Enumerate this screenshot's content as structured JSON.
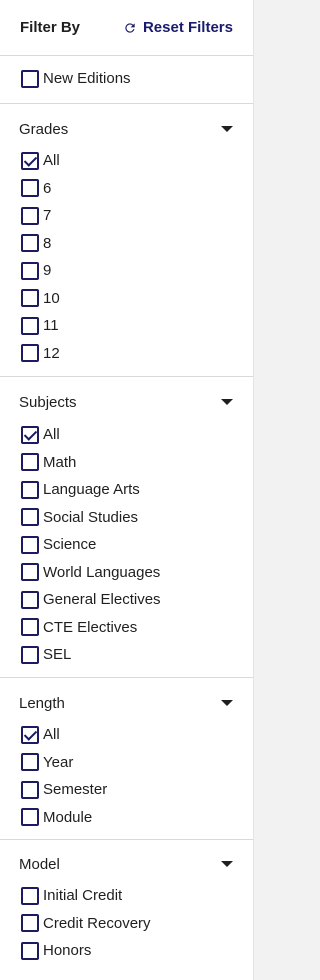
{
  "header": {
    "title": "Filter By",
    "reset_label": "Reset Filters"
  },
  "new_editions": {
    "label": "New Editions",
    "checked": false
  },
  "sections": [
    {
      "key": "grades",
      "title": "Grades",
      "options": [
        {
          "label": "All",
          "checked": true
        },
        {
          "label": "6",
          "checked": false
        },
        {
          "label": "7",
          "checked": false
        },
        {
          "label": "8",
          "checked": false
        },
        {
          "label": "9",
          "checked": false
        },
        {
          "label": "10",
          "checked": false
        },
        {
          "label": "11",
          "checked": false
        },
        {
          "label": "12",
          "checked": false
        }
      ]
    },
    {
      "key": "subjects",
      "title": "Subjects",
      "options": [
        {
          "label": "All",
          "checked": true
        },
        {
          "label": "Math",
          "checked": false
        },
        {
          "label": "Language Arts",
          "checked": false
        },
        {
          "label": "Social Studies",
          "checked": false
        },
        {
          "label": "Science",
          "checked": false
        },
        {
          "label": "World Languages",
          "checked": false
        },
        {
          "label": "General Electives",
          "checked": false
        },
        {
          "label": "CTE Electives",
          "checked": false
        },
        {
          "label": "SEL",
          "checked": false
        }
      ]
    },
    {
      "key": "length",
      "title": "Length",
      "options": [
        {
          "label": "All",
          "checked": true
        },
        {
          "label": "Year",
          "checked": false
        },
        {
          "label": "Semester",
          "checked": false
        },
        {
          "label": "Module",
          "checked": false
        }
      ]
    },
    {
      "key": "model",
      "title": "Model",
      "options": [
        {
          "label": "Initial Credit",
          "checked": false
        },
        {
          "label": "Credit Recovery",
          "checked": false
        },
        {
          "label": "Honors",
          "checked": false
        }
      ]
    }
  ],
  "colors": {
    "accent": "#1b1b5e",
    "link": "#1b1b6e",
    "divider": "#d9d9d9"
  }
}
